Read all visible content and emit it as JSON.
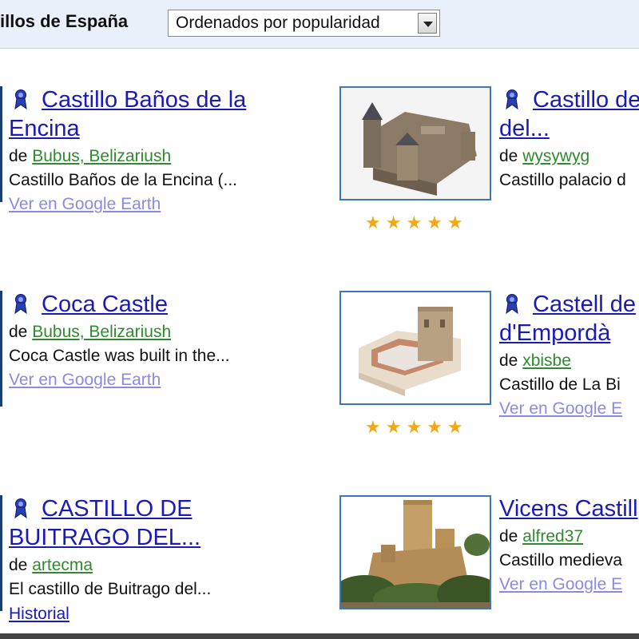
{
  "header": {
    "title": "illos de España",
    "sort_value": "Ordenados por popularidad"
  },
  "items": [
    {
      "title_line1": "Castillo Baños de la",
      "title_line2": "Encina",
      "by": "de",
      "author": "Bubus, Belizariush",
      "desc": "Castillo Baños de la Encina (...",
      "link": "Ver en Google Earth"
    },
    {
      "title_line1": "Castillo de",
      "title_line2": "del...",
      "by": "de",
      "author": "wysywyg",
      "desc": "Castillo palacio d",
      "rating": 5
    },
    {
      "title_line1": "Coca Castle",
      "by": "de",
      "author": "Bubus, Belizariush",
      "desc": "Coca Castle was built in the...",
      "link": "Ver en Google Earth"
    },
    {
      "title_line1": "Castell de",
      "title_line2": "d'Empordà",
      "by": "de",
      "author": "xbisbe",
      "desc": "Castillo de La Bi",
      "link": "Ver en Google E",
      "rating": 5
    },
    {
      "title_line1": "CASTILLO DE",
      "title_line2": "BUITRAGO DEL...",
      "by": "de",
      "author": "artecma",
      "desc": "El castillo de Buitrago del...",
      "link": "Historial"
    },
    {
      "title_line1": "Vicens Castill",
      "by": "de",
      "author": "alfred37",
      "desc": "Castillo medieva",
      "link": "Ver en Google E"
    }
  ],
  "stars_glyph": "★★★★★",
  "colors": {
    "link": "#1a1ab8",
    "author": "#2e8b2e",
    "visited": "#8a8ae6",
    "star": "#f0a818",
    "thumb_border": "#3e74b8"
  }
}
